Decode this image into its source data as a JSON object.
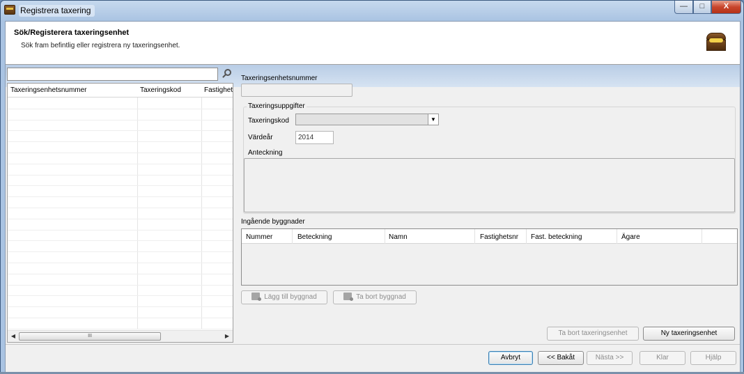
{
  "window": {
    "title": "Registrera taxering",
    "controls": {
      "minimize": "—",
      "maximize": "□",
      "close": "X"
    }
  },
  "header": {
    "title": "Sök/Registerera taxeringsenhet",
    "subtitle": "Sök fram befintlig eller registrera ny taxeringsenhet.",
    "icon": "treasure-chest-icon"
  },
  "search": {
    "value": "",
    "placeholder": "",
    "icon": "search-icon"
  },
  "results_list": {
    "columns": [
      "Taxeringsenhetsnummer",
      "Taxeringskod",
      "Fastighet"
    ],
    "rows": [],
    "scroll_thumb_label": "III"
  },
  "form": {
    "unit_number_label": "Taxeringsenhetsnummer",
    "unit_number_value": "",
    "group_label": "Taxeringsuppgifter",
    "code_label": "Taxeringskod",
    "code_value": "",
    "year_label": "Värdeår",
    "year_value": "2014",
    "note_label": "Anteckning",
    "note_value": ""
  },
  "buildings": {
    "label": "Ingående byggnader",
    "columns": [
      "Nummer",
      "Beteckning",
      "Namn",
      "Fastighetsnr",
      "Fast. beteckning",
      "Ägare"
    ],
    "rows": [],
    "add_button": "Lägg till byggnad",
    "remove_button": "Ta bort byggnad"
  },
  "unit_actions": {
    "remove_button": "Ta bort taxeringsenhet",
    "new_button": "Ny taxeringsenhet"
  },
  "wizard": {
    "cancel": "Avbryt",
    "back": "<< Bakåt",
    "next": "Nästa >>",
    "finish": "Klar",
    "help": "Hjälp"
  }
}
